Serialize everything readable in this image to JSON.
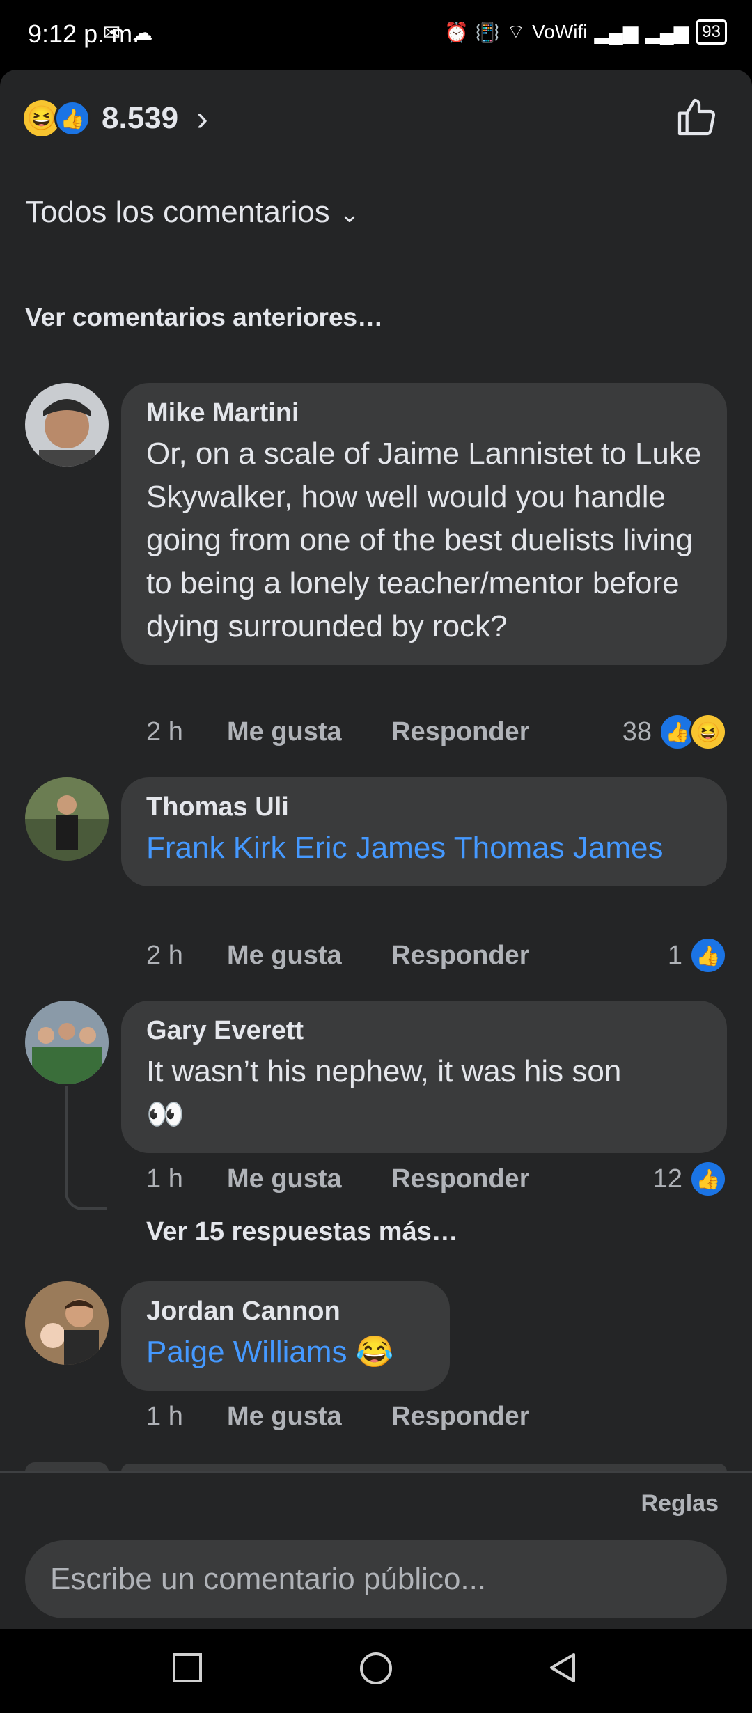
{
  "status": {
    "time": "9:12 p. m.",
    "left_icons": [
      "mail-icon",
      "cloud-icon"
    ],
    "vowifi": "VoWifi",
    "battery": "93"
  },
  "reactions": {
    "total": "8.539",
    "types": [
      "haha",
      "like"
    ]
  },
  "sort_label": "Todos los comentarios",
  "prev_comments": "Ver comentarios anteriores…",
  "comments": [
    {
      "author": "Mike Martini",
      "text": "Or, on a scale of Jaime Lannistet to Luke Skywalker, how well would you handle going from one of the best duelists living to being a lonely teacher/mentor before dying surrounded by rock?",
      "time": "2 h",
      "like": "Me gusta",
      "reply": "Responder",
      "reaction_count": "38"
    },
    {
      "author": "Thomas Uli",
      "text": "Frank Kirk Eric James Thomas James",
      "time": "2 h",
      "like": "Me gusta",
      "reply": "Responder",
      "reaction_count": "1"
    },
    {
      "author": "Gary Everett",
      "text": "It wasn’t his nephew, it was his son",
      "emoji": "👀",
      "time": "1 h",
      "like": "Me gusta",
      "reply": "Responder",
      "reaction_count": "12",
      "more_replies": "Ver 15 respuestas más…"
    },
    {
      "author": "Jordan Cannon",
      "text": "Paige Williams",
      "emoji": "😂",
      "time": "1 h",
      "like": "Me gusta",
      "reply": "Responder"
    }
  ],
  "rules": "Reglas",
  "compose_placeholder": "Escribe un comentario público...",
  "colors": {
    "background": "#242526",
    "bubble": "#3a3b3c",
    "mention": "#4599ff",
    "like_blue": "#1b74e4",
    "haha_yellow": "#f7c430"
  }
}
